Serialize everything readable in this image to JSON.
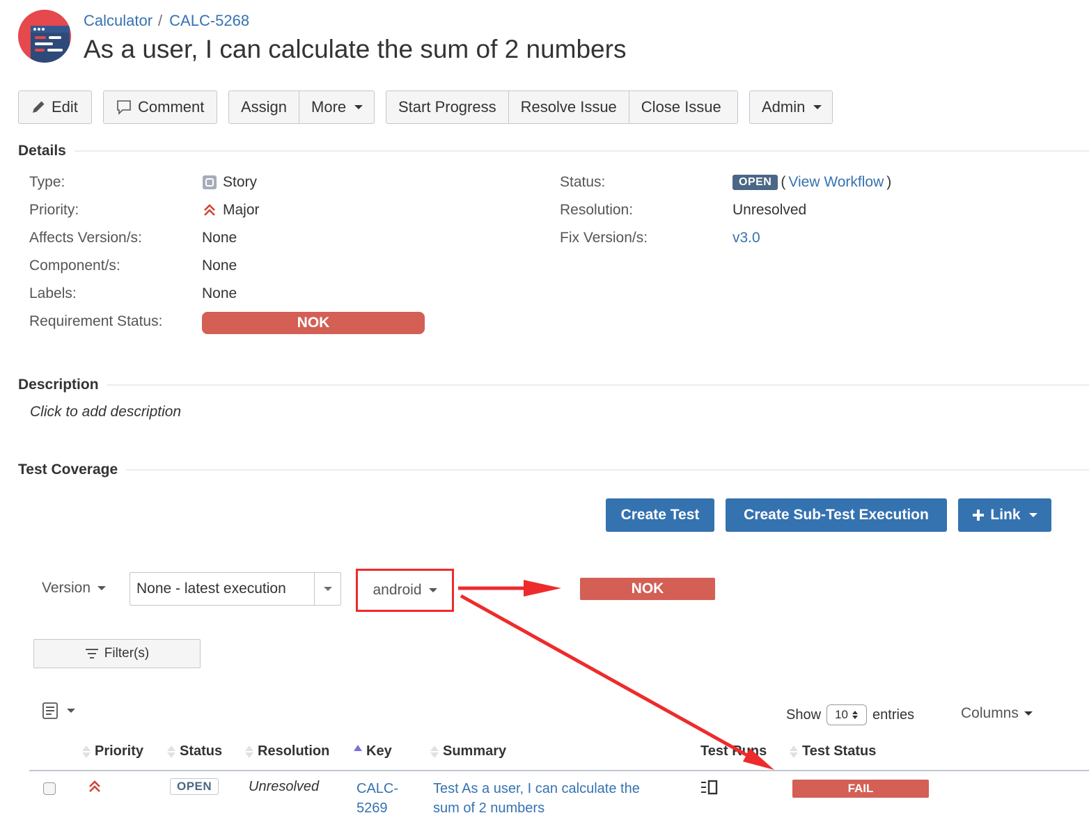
{
  "colors": {
    "link": "#3572b0",
    "nok": "#d35f55",
    "open_lozenge": "#4a6785",
    "primary": "#3572b0",
    "annotation": "#ee2b2b"
  },
  "breadcrumb": {
    "project": "Calculator",
    "separator": "/",
    "issue_key": "CALC-5268"
  },
  "title": "As a user, I can calculate the sum of 2 numbers",
  "toolbar": {
    "edit": "Edit",
    "comment": "Comment",
    "assign": "Assign",
    "more": "More",
    "start_progress": "Start Progress",
    "resolve_issue": "Resolve Issue",
    "close_issue": "Close Issue",
    "admin": "Admin"
  },
  "details": {
    "heading": "Details",
    "type_label": "Type:",
    "type_value": "Story",
    "priority_label": "Priority:",
    "priority_value": "Major",
    "affects_label": "Affects Version/s:",
    "affects_value": "None",
    "components_label": "Component/s:",
    "components_value": "None",
    "labels_label": "Labels:",
    "labels_value": "None",
    "req_status_label": "Requirement Status:",
    "req_status_value": "NOK",
    "status_label": "Status:",
    "status_value": "OPEN",
    "view_workflow": "View Workflow",
    "resolution_label": "Resolution:",
    "resolution_value": "Unresolved",
    "fix_label": "Fix Version/s:",
    "fix_value": "v3.0"
  },
  "description": {
    "heading": "Description",
    "placeholder": "Click to add description"
  },
  "coverage": {
    "heading": "Test Coverage",
    "create_test": "Create Test",
    "create_sub_exec": "Create Sub-Test Execution",
    "link": "Link",
    "version_label": "Version",
    "version_value": "None - latest execution",
    "environment_value": "android",
    "environment_status": "NOK",
    "filters": "Filter(s)",
    "show": "Show",
    "page_size": "10",
    "entries": "entries",
    "columns": "Columns"
  },
  "table": {
    "headers": {
      "priority": "Priority",
      "status": "Status",
      "resolution": "Resolution",
      "key": "Key",
      "summary": "Summary",
      "test_runs": "Test Runs",
      "test_status": "Test Status"
    },
    "rows": [
      {
        "status": "OPEN",
        "resolution": "Unresolved",
        "key_line1": "CALC-",
        "key_line2": "5269",
        "summary": "Test As a user, I can calculate the sum of 2 numbers",
        "test_status": "FAIL"
      }
    ]
  }
}
